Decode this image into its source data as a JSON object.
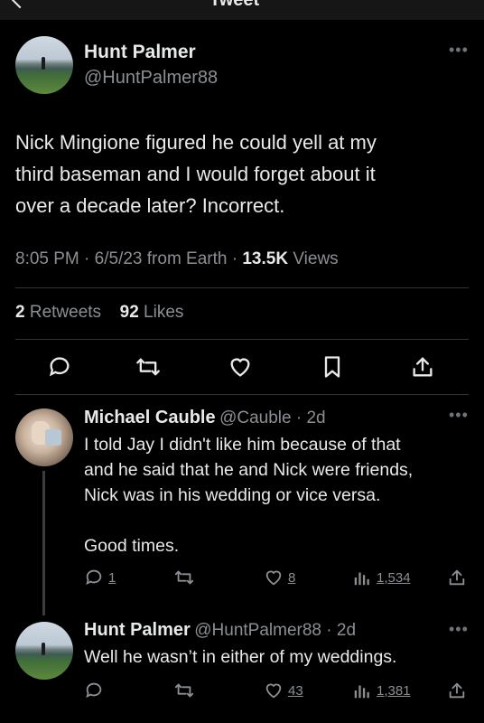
{
  "header": {
    "title": "Tweet"
  },
  "tweet": {
    "author_name": "Hunt Palmer",
    "author_handle": "@HuntPalmer88",
    "lines": [
      "Nick Mingione figured he could yell at my",
      "third baseman and I would forget about it",
      "over a decade later? Incorrect."
    ],
    "time": "8:05 PM",
    "date": "6/5/23",
    "source": "from Earth",
    "views_count": "13.5K",
    "views_label": "Views",
    "retweets_count": "2",
    "retweets_label": "Retweets",
    "likes_count": "92",
    "likes_label": "Likes",
    "actions": [
      "reply-icon",
      "retweet-icon",
      "heart-icon",
      "bookmark-icon",
      "share-icon"
    ]
  },
  "replies": [
    {
      "author_name": "Michael Cauble",
      "author_handle": "@Cauble",
      "age": "2d",
      "lines": [
        "I told Jay I didn't like him because of that",
        "and he said that he and Nick were friends,",
        "Nick was in his wedding or vice versa.",
        "",
        "Good times."
      ],
      "reply_count": "1",
      "like_count": "8",
      "view_count": "1,534"
    },
    {
      "author_name": "Hunt Palmer",
      "author_handle": "@HuntPalmer88",
      "age": "2d",
      "lines": [
        "Well he wasn’t in either of my weddings."
      ],
      "reply_count": "",
      "like_count": "43",
      "view_count": "1,381"
    }
  ]
}
